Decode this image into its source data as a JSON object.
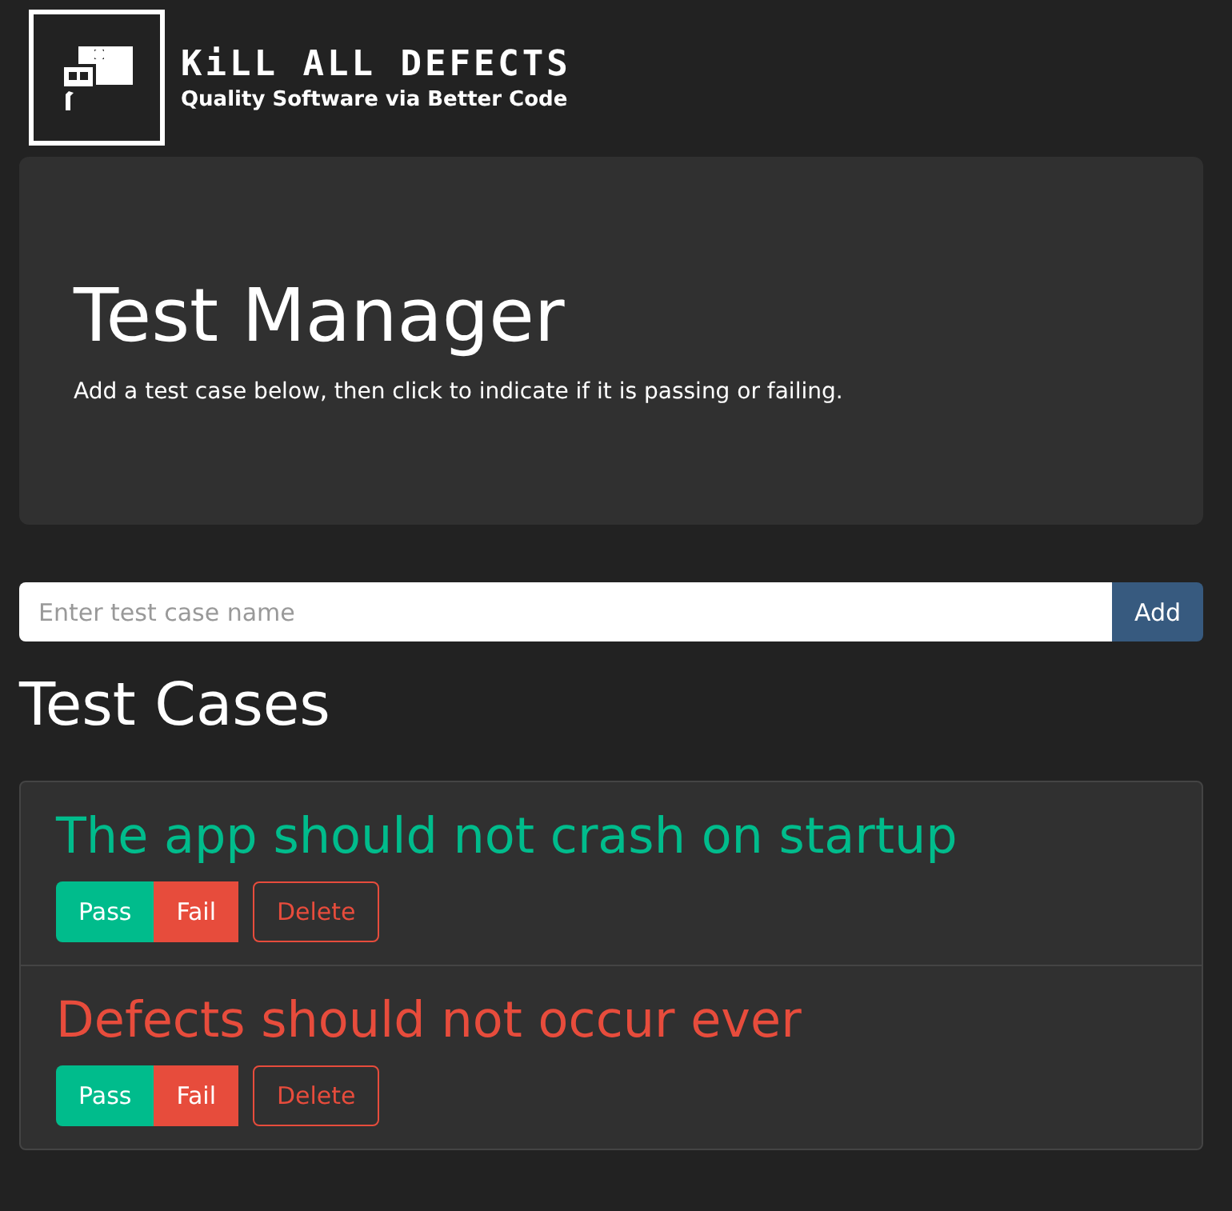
{
  "logo": {
    "title": "KiLL ALL DEFECTS",
    "tagline": "Quality Software via Better Code"
  },
  "hero": {
    "title": "Test Manager",
    "text": "Add a test case below, then click to indicate if it is passing or failing."
  },
  "add_form": {
    "placeholder": "Enter test case name",
    "button": "Add"
  },
  "section_title": "Test Cases",
  "test_cases": [
    {
      "name": "The app should not crash on startup",
      "passing": true,
      "pass_label": "Pass",
      "fail_label": "Fail",
      "delete_label": "Delete"
    },
    {
      "name": "Defects should not occur ever",
      "passing": false,
      "pass_label": "Pass",
      "fail_label": "Fail",
      "delete_label": "Delete"
    }
  ]
}
